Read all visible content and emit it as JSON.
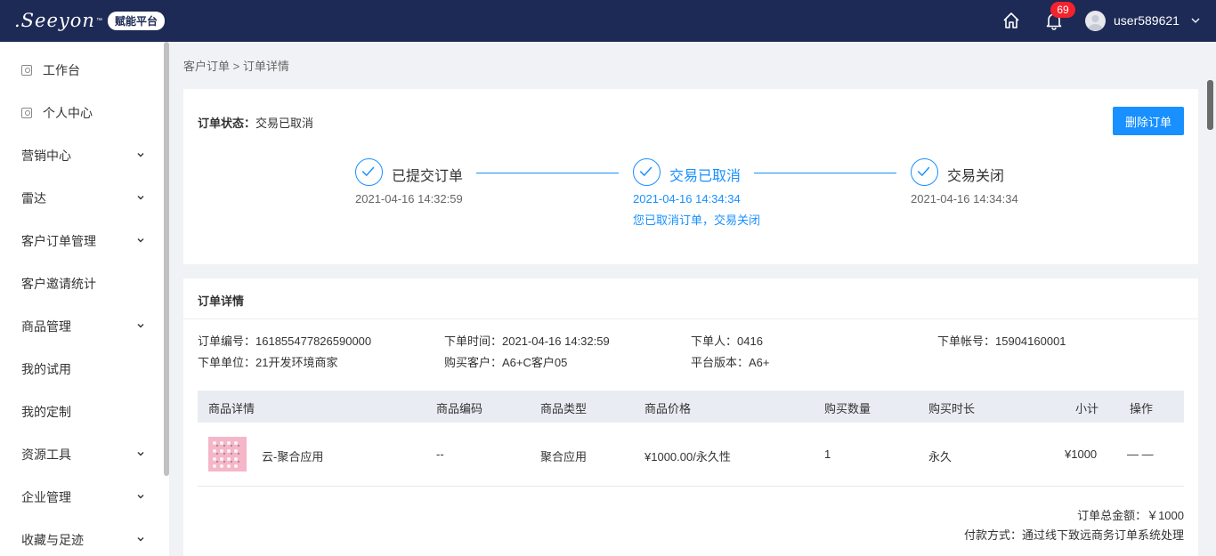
{
  "topbar": {
    "logo_text": ".Seeyon",
    "logo_tm": "™",
    "logo_badge": "赋能平台",
    "notification_count": "69",
    "username": "user589621"
  },
  "sidebar": {
    "items": [
      {
        "label": "工作台",
        "icon": "workbench-icon",
        "expandable": false
      },
      {
        "label": "个人中心",
        "icon": "personal-icon",
        "expandable": false
      },
      {
        "label": "营销中心",
        "expandable": true
      },
      {
        "label": "雷达",
        "expandable": true
      },
      {
        "label": "客户订单管理",
        "expandable": true
      },
      {
        "label": "客户邀请统计",
        "expandable": false
      },
      {
        "label": "商品管理",
        "expandable": true
      },
      {
        "label": "我的试用",
        "expandable": false
      },
      {
        "label": "我的定制",
        "expandable": false
      },
      {
        "label": "资源工具",
        "expandable": true
      },
      {
        "label": "企业管理",
        "expandable": true
      },
      {
        "label": "收藏与足迹",
        "expandable": true
      }
    ]
  },
  "breadcrumb": {
    "parent": "客户订单",
    "separator": ">",
    "current": "订单详情"
  },
  "order_status": {
    "label": "订单状态：",
    "value": "交易已取消",
    "delete_button": "删除订单"
  },
  "steps": [
    {
      "title": "已提交订单",
      "time": "2021-04-16 14:32:59",
      "active": false
    },
    {
      "title": "交易已取消",
      "time": "2021-04-16 14:34:34",
      "desc": "您已取消订单，交易关闭",
      "active": true
    },
    {
      "title": "交易关闭",
      "time": "2021-04-16 14:34:34",
      "active": false
    }
  ],
  "order_detail": {
    "title": "订单详情",
    "fields": {
      "order_no": "订单编号：161855477826590000",
      "order_time": "下单时间：2021-04-16 14:32:59",
      "orderer": "下单人：0416",
      "account": "下单帐号：15904160001",
      "unit": "下单单位：21开发环境商家",
      "customer": "购买客户：A6+C客户05",
      "platform": "平台版本：A6+"
    }
  },
  "table": {
    "headers": [
      "商品详情",
      "商品编码",
      "商品类型",
      "商品价格",
      "购买数量",
      "购买时长",
      "小计",
      "操作"
    ],
    "rows": [
      {
        "name": "云-聚合应用",
        "code": "--",
        "type": "聚合应用",
        "price": "¥1000.00/永久性",
        "qty": "1",
        "duration": "永久",
        "subtotal": "¥1000",
        "action": "— —"
      }
    ]
  },
  "summary": {
    "total": "订单总金额：￥1000",
    "payment": "付款方式：通过线下致远商务订单系统处理"
  }
}
